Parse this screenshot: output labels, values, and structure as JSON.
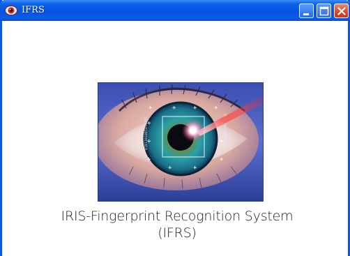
{
  "window": {
    "title": "IFRS",
    "app_icon": "eye-icon",
    "controls": [
      "minimize-icon",
      "maximize-icon",
      "close-icon"
    ]
  },
  "splash": {
    "image": "iris-scan-eye",
    "caption_line1": "IRIS-Fingerprint Recognition System",
    "caption_line2": "(IFRS)"
  },
  "colors": {
    "titlebar": "#0753df",
    "close_button": "#d6492a",
    "background": "#ffffff"
  }
}
